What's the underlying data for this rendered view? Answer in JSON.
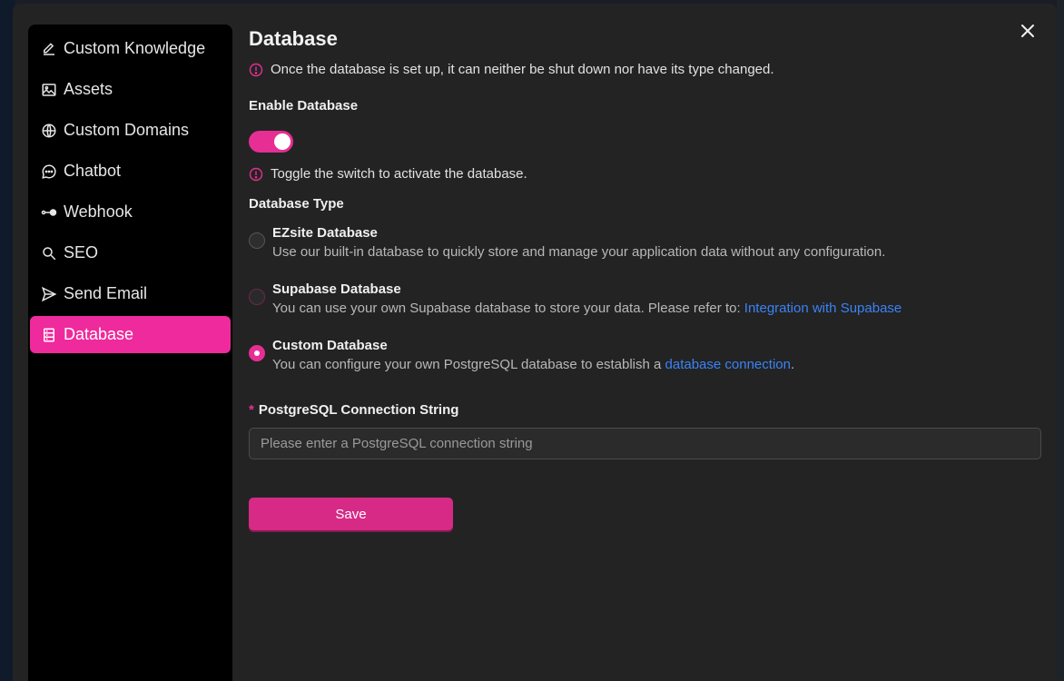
{
  "sidebar": {
    "items": [
      {
        "label": "Custom Knowledge",
        "icon": "pencil-icon"
      },
      {
        "label": "Assets",
        "icon": "image-icon"
      },
      {
        "label": "Custom Domains",
        "icon": "globe-icon"
      },
      {
        "label": "Chatbot",
        "icon": "chat-bubble-icon"
      },
      {
        "label": "Webhook",
        "icon": "webhook-icon"
      },
      {
        "label": "SEO",
        "icon": "search-icon"
      },
      {
        "label": "Send Email",
        "icon": "send-icon"
      },
      {
        "label": "Database",
        "icon": "database-icon",
        "active": true
      }
    ]
  },
  "main": {
    "title": "Database",
    "setup_notice": "Once the database is set up, it can neither be shut down nor have its type changed.",
    "enable_label": "Enable Database",
    "toggle_enabled": true,
    "toggle_hint": "Toggle the switch to activate the database.",
    "type_label": "Database Type",
    "options": [
      {
        "title": "EZsite Database",
        "desc": "Use our built-in database to quickly store and manage your application data without any configuration.",
        "checked": false
      },
      {
        "title": "Supabase Database",
        "desc": "You can use your own Supabase database to store your data. Please refer to: ",
        "link": "Integration with Supabase",
        "checked": false
      },
      {
        "title": "Custom Database",
        "desc": "You can configure your own PostgreSQL database to establish a ",
        "link": "database connection",
        "desc_suffix": ".",
        "checked": true
      }
    ],
    "connection": {
      "required_mark": "*",
      "label": "PostgreSQL Connection String",
      "value": "",
      "placeholder": "Please enter a PostgreSQL connection string"
    },
    "save_label": "Save"
  },
  "colors": {
    "accent": "#ef2a9c",
    "link": "#3b82f6",
    "background": "#232323",
    "sidebar": "#000000"
  }
}
